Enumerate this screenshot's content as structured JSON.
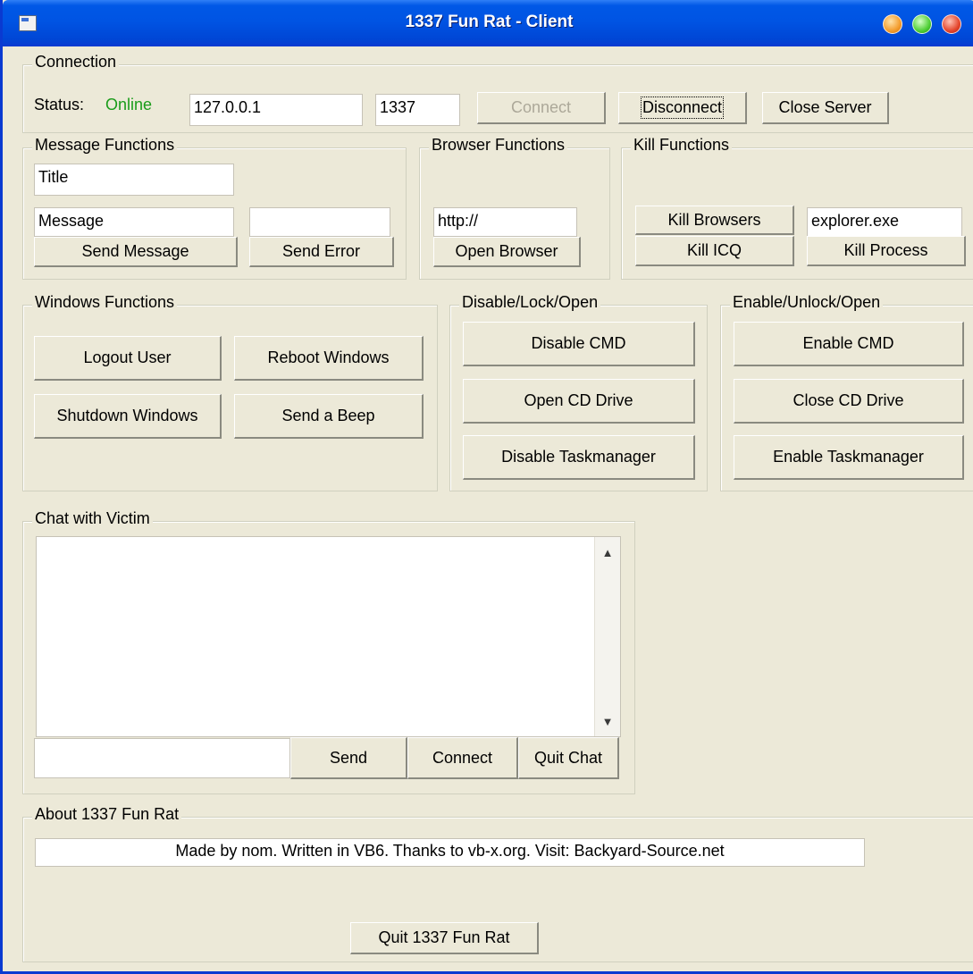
{
  "window": {
    "title": "1337 Fun Rat - Client"
  },
  "connection": {
    "frame_label": "Connection",
    "status_label": "Status:",
    "status_value": "Online",
    "status_color": "#1a9c1a",
    "ip": "127.0.0.1",
    "port": "1337",
    "connect_label": "Connect",
    "disconnect_label": "Disconnect",
    "close_server_label": "Close Server"
  },
  "message": {
    "frame_label": "Message Functions",
    "title_value": "Title",
    "message_value": "Message",
    "error_value": "",
    "send_message_label": "Send Message",
    "send_error_label": "Send Error"
  },
  "browser": {
    "frame_label": "Browser Functions",
    "url_value": "http://",
    "open_browser_label": "Open Browser"
  },
  "kill": {
    "frame_label": "Kill Functions",
    "kill_browsers_label": "Kill Browsers",
    "kill_icq_label": "Kill ICQ",
    "process_value": "explorer.exe",
    "kill_process_label": "Kill Process"
  },
  "windows": {
    "frame_label": "Windows Functions",
    "logout_label": "Logout User",
    "reboot_label": "Reboot Windows",
    "shutdown_label": "Shutdown Windows",
    "beep_label": "Send a Beep"
  },
  "disable": {
    "frame_label": "Disable/Lock/Open",
    "disable_cmd_label": "Disable CMD",
    "open_cd_label": "Open CD Drive",
    "disable_task_label": "Disable Taskmanager"
  },
  "enable": {
    "frame_label": "Enable/Unlock/Open",
    "enable_cmd_label": "Enable CMD",
    "close_cd_label": "Close CD Drive",
    "enable_task_label": "Enable Taskmanager"
  },
  "chat": {
    "frame_label": "Chat with Victim",
    "log_value": "",
    "input_value": "",
    "send_label": "Send",
    "connect_label": "Connect",
    "quit_label": "Quit Chat"
  },
  "about": {
    "frame_label": "About 1337 Fun Rat",
    "text": "Made by nom. Written in VB6. Thanks to vb-x.org. Visit: Backyard-Source.net",
    "quit_label": "Quit 1337 Fun Rat"
  }
}
